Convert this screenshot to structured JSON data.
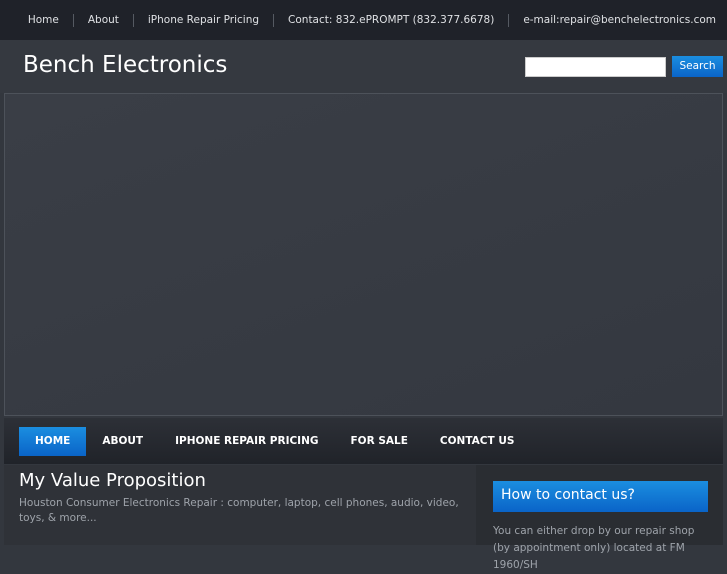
{
  "topbar": {
    "links": [
      "Home",
      "About",
      "iPhone Repair Pricing",
      "Contact: 832.ePROMPT (832.377.6678)",
      "e-mail:repair@benchelectronics.com"
    ]
  },
  "header": {
    "title": "Bench Electronics",
    "search_placeholder": "",
    "search_label": "Search"
  },
  "nav": {
    "items": [
      "HOME",
      "ABOUT",
      "IPHONE REPAIR PRICING",
      "FOR SALE",
      "CONTACT US"
    ]
  },
  "main": {
    "title": "My Value Proposition",
    "text": "Houston Consumer Electronics Repair : computer, laptop, cell phones, audio, video, toys, & more..."
  },
  "sidebar": {
    "widget_title": "How to contact us?",
    "text": "You can either drop by our repair shop (by appointment only) located at FM 1960/SH"
  }
}
